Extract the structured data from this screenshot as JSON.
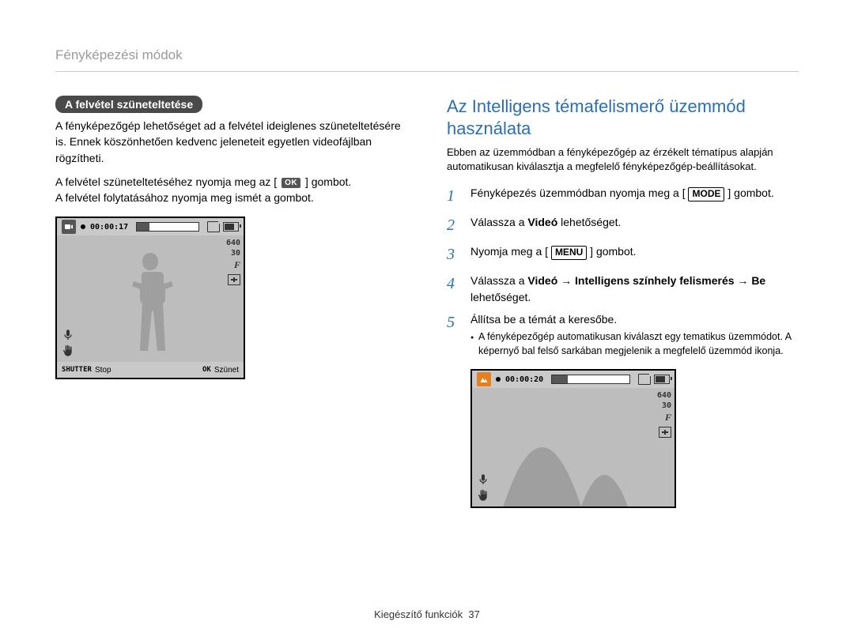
{
  "header": "Fényképezési módok",
  "left": {
    "pill": "A felvétel szüneteltetése",
    "p1": "A fényképezőgép lehetőséget ad a felvétel ideiglenes szüneteltetésére is. Ennek köszönhetően kedvenc jeleneteit egyetlen videofájlban rögzítheti.",
    "p2a": "A felvétel szüneteltetéséhez nyomja meg az [",
    "p2b": "] gombot.",
    "p3": "A felvétel folytatásához nyomja meg ismét a gombot.",
    "ok": "OK",
    "lcd": {
      "time": "00:00:17",
      "res": "640",
      "fps": "30",
      "shutter": "SHUTTER",
      "stop": "Stop",
      "okl": "OK",
      "pause": "Szünet"
    }
  },
  "right": {
    "title": "Az Intelligens témafelismerő üzemmód használata",
    "intro": "Ebben az üzemmódban a fényképezőgép az érzékelt tématípus alapján automatikusan kiválasztja a megfelelő fényképezőgép-beállításokat.",
    "s1a": "Fényképezés üzemmódban nyomja meg a [",
    "s1mode": "MODE",
    "s1b": "] gombot.",
    "s2a": "Válassza a ",
    "s2b": "Videó",
    "s2c": " lehetőséget.",
    "s3a": "Nyomja meg a [",
    "s3menu": "MENU",
    "s3b": "] gombot.",
    "s4a": "Válassza a ",
    "s4b": "Videó → Intelligens színhely felismerés → Be",
    "s4c": " lehetőséget.",
    "s5": "Állítsa be a témát a keresőbe.",
    "s5sub": "A fényképezőgép automatikusan kiválaszt egy tematikus üzemmódot. A képernyő bal felső sarkában megjelenik a megfelelő üzemmód ikonja.",
    "lcd": {
      "time": "00:00:20",
      "res": "640",
      "fps": "30"
    }
  },
  "footer": {
    "label": "Kiegészítő funkciók",
    "page": "37"
  }
}
